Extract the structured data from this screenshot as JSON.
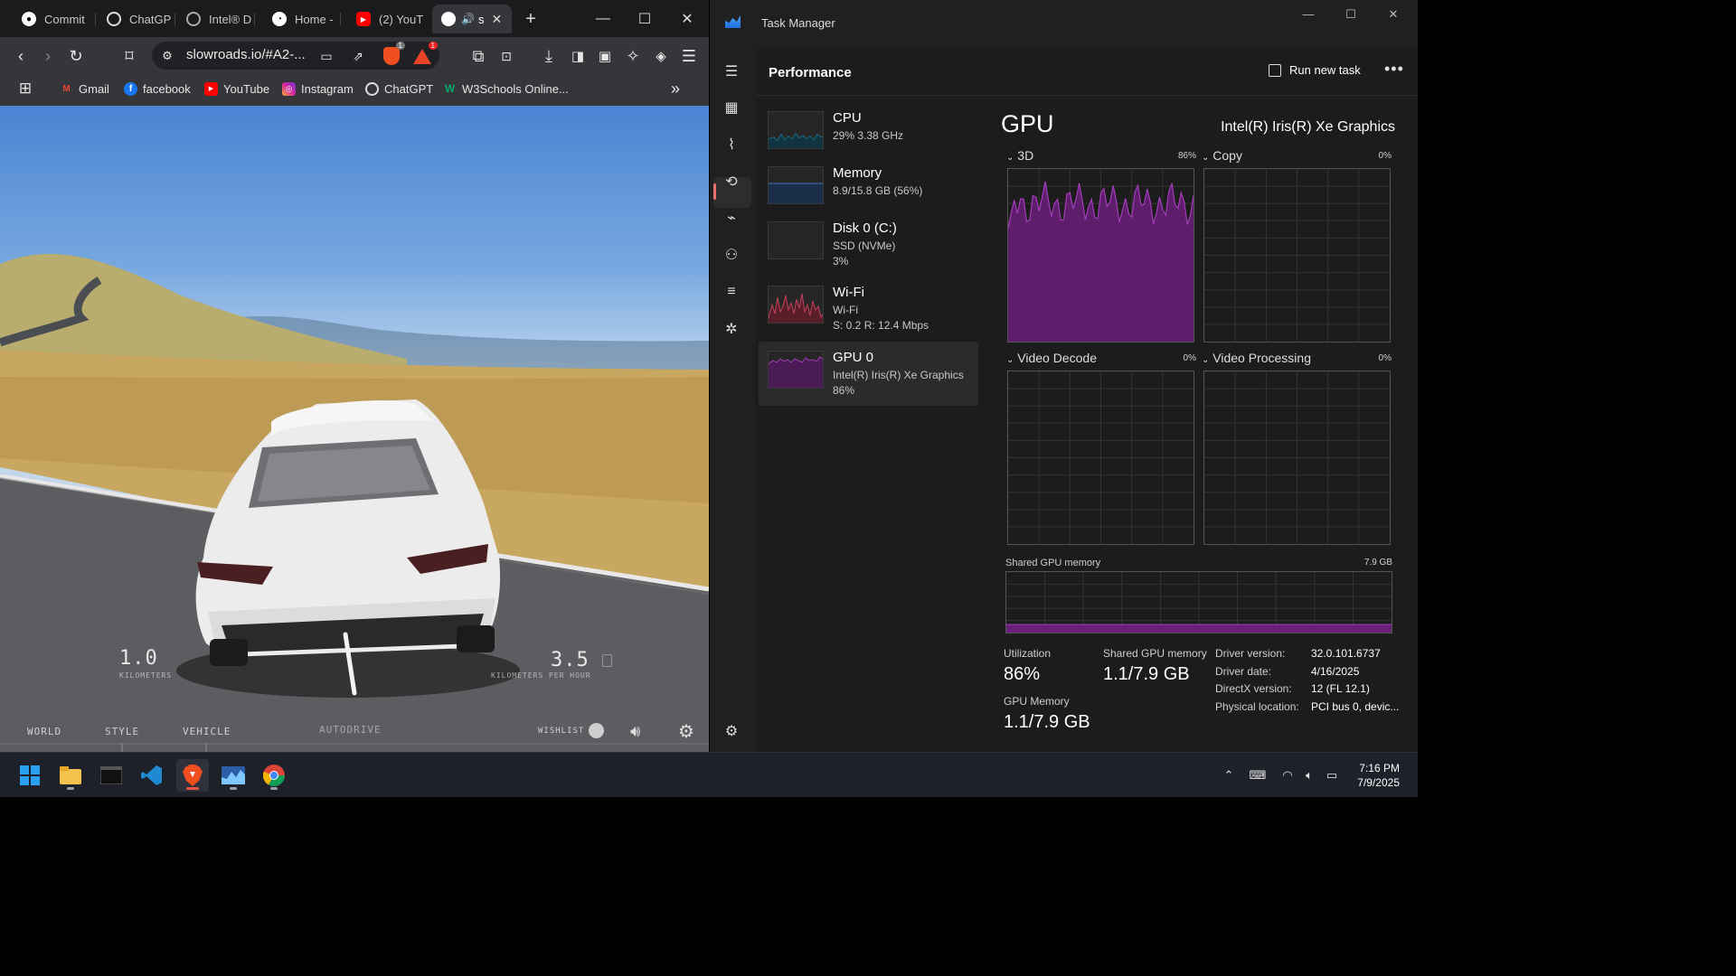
{
  "browser": {
    "tabs": [
      {
        "label": "Commit",
        "icon": "github-icon"
      },
      {
        "label": "ChatGP",
        "icon": "chatgpt-icon"
      },
      {
        "label": "Intel® D",
        "icon": "globe-icon"
      },
      {
        "label": "Home -",
        "icon": "home-icon"
      },
      {
        "label": "(2) YouT",
        "icon": "youtube-icon"
      },
      {
        "label": "s",
        "icon": "slowroads-icon"
      }
    ],
    "url": "slowroads.io/#A2-...",
    "shields_badge": "1",
    "rewards_badge": "1",
    "bookmarks": [
      {
        "label": "Gmail",
        "icon": "gmail-icon",
        "color": "#ea4335"
      },
      {
        "label": "facebook",
        "icon": "facebook-icon",
        "color": "#1877f2"
      },
      {
        "label": "YouTube",
        "icon": "youtube-icon",
        "color": "#ff0000"
      },
      {
        "label": "Instagram",
        "icon": "instagram-icon",
        "color": "#d6249f"
      },
      {
        "label": "ChatGPT",
        "icon": "chatgpt-icon",
        "color": "#dddddd"
      },
      {
        "label": "W3Schools Online...",
        "icon": "w3schools-icon",
        "color": "#04aa6d"
      }
    ]
  },
  "game": {
    "distance_value": "1.0",
    "distance_unit": "KILOMETERS",
    "speed_value": "3.5",
    "speed_unit": "KILOMETERS PER HOUR",
    "menu": [
      "WORLD",
      "STYLE",
      "VEHICLE"
    ],
    "autodrive": "AUTODRIVE",
    "wishlist": "WISHLIST"
  },
  "taskmanager": {
    "title": "Task Manager",
    "header": "Performance",
    "run_new_task": "Run new task",
    "resources": [
      {
        "name": "CPU",
        "lines": [
          "29%  3.38 GHz"
        ],
        "color": "#1aa0c8"
      },
      {
        "name": "Memory",
        "lines": [
          "8.9/15.8 GB (56%)"
        ],
        "color": "#3a6fb0"
      },
      {
        "name": "Disk 0 (C:)",
        "lines": [
          "SSD (NVMe)",
          "3%"
        ],
        "color": "#4caf50"
      },
      {
        "name": "Wi-Fi",
        "lines": [
          "Wi-Fi",
          "S: 0.2  R: 12.4 Mbps"
        ],
        "color": "#c2415b"
      },
      {
        "name": "GPU 0",
        "lines": [
          "Intel(R) Iris(R) Xe Graphics",
          "86%"
        ],
        "color": "#a33dbb"
      }
    ],
    "gpu": {
      "title": "GPU",
      "adapter": "Intel(R) Iris(R) Xe Graphics",
      "engines": [
        {
          "label": "3D",
          "pct": "86%"
        },
        {
          "label": "Copy",
          "pct": "0%"
        },
        {
          "label": "Video Decode",
          "pct": "0%"
        },
        {
          "label": "Video Processing",
          "pct": "0%"
        }
      ],
      "shared_memory_label": "Shared GPU memory",
      "shared_memory_max": "7.9 GB",
      "utilization_label": "Utilization",
      "utilization": "86%",
      "shared_label": "Shared GPU memory",
      "shared_value": "1.1/7.9 GB",
      "gpu_memory_label": "GPU Memory",
      "gpu_memory_value": "1.1/7.9 GB",
      "details": [
        {
          "k": "Driver version:",
          "v": "32.0.101.6737"
        },
        {
          "k": "Driver date:",
          "v": "4/16/2025"
        },
        {
          "k": "DirectX version:",
          "v": "12 (FL 12.1)"
        },
        {
          "k": "Physical location:",
          "v": "PCI bus 0, devic..."
        }
      ],
      "graph_color": "#a33dbb"
    }
  },
  "taskbar": {
    "time": "7:16 PM",
    "date": "7/9/2025"
  }
}
